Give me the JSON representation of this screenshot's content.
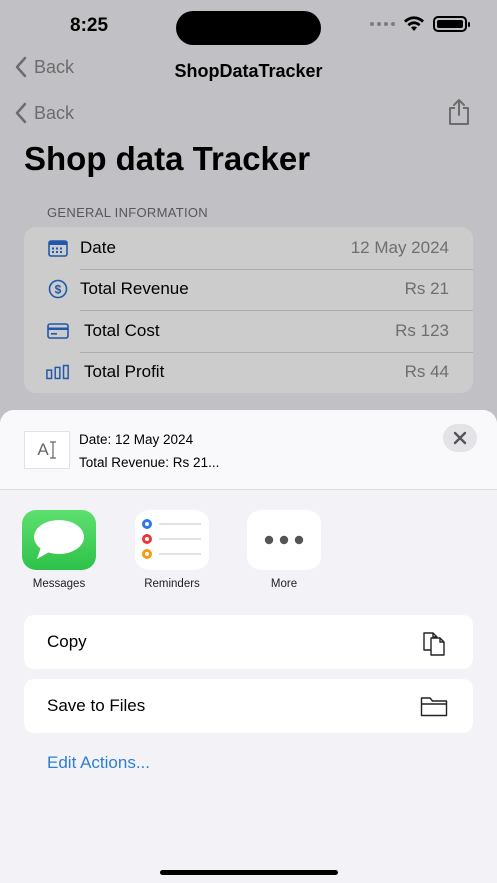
{
  "status": {
    "time": "8:25"
  },
  "nav": {
    "back_label": "Back",
    "title": "ShopDataTracker",
    "back_label_2": "Back"
  },
  "page": {
    "title": "Shop data Tracker",
    "section_header": "GENERAL INFORMATION"
  },
  "info_rows": [
    {
      "label": "Date",
      "value": "12 May 2024",
      "icon": "calendar-icon"
    },
    {
      "label": "Total Revenue",
      "value": "Rs 21",
      "icon": "dollar-icon"
    },
    {
      "label": "Total Cost",
      "value": "Rs 123",
      "icon": "credit-card-icon"
    },
    {
      "label": "Total Profit",
      "value": "Rs 44",
      "icon": "bar-chart-icon"
    }
  ],
  "share_sheet": {
    "preview_thumb": "A",
    "preview_line1": "Date: 12 May 2024",
    "preview_line2": "Total Revenue: Rs 21...",
    "apps": [
      {
        "label": "Messages",
        "icon": "messages-icon"
      },
      {
        "label": "Reminders",
        "icon": "reminders-icon"
      },
      {
        "label": "More",
        "icon": "more-icon"
      }
    ],
    "actions": [
      {
        "label": "Copy",
        "icon": "copy-icon"
      },
      {
        "label": "Save to Files",
        "icon": "folder-icon"
      }
    ],
    "edit_actions": "Edit Actions..."
  },
  "colors": {
    "accent": "#2f7fd0",
    "messages_green": "#34c759",
    "icon_blue": "#2a6fd6"
  }
}
